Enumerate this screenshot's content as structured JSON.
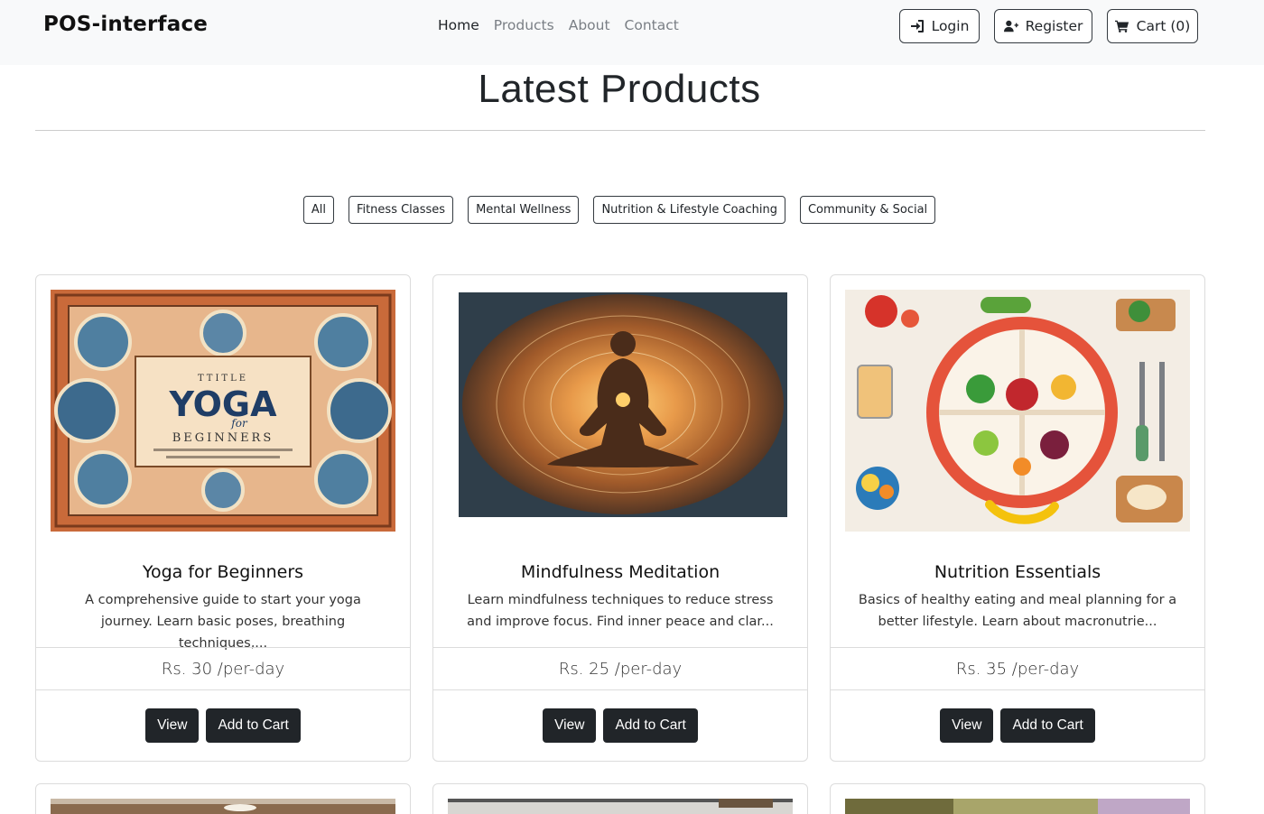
{
  "navbar": {
    "brand": "POS-interface",
    "links": [
      {
        "label": "Home",
        "active": true
      },
      {
        "label": "Products",
        "active": false
      },
      {
        "label": "About",
        "active": false
      },
      {
        "label": "Contact",
        "active": false
      }
    ],
    "login_label": "Login",
    "register_label": "Register",
    "cart_label": "Cart (0)",
    "icons": {
      "login": "sign-in-icon",
      "register": "user-plus-icon",
      "cart": "shopping-cart-icon"
    }
  },
  "main": {
    "title": "Latest Products",
    "filters": [
      "All",
      "Fitness Classes",
      "Mental Wellness",
      "Nutrition & Lifestyle Coaching",
      "Community & Social"
    ]
  },
  "products": [
    {
      "title": "Yoga for Beginners",
      "description": "A comprehensive guide to start your yoga journey. Learn basic poses, breathing techniques,...",
      "price": "Rs. 30 /per-day",
      "view_label": "View",
      "cart_label": "Add to Cart",
      "image": "yoga-book-cover-image",
      "image_text": {
        "line1": "TTITLE",
        "line2": "YOGA",
        "line3": "for",
        "line4": "BEGINNERS"
      }
    },
    {
      "title": "Mindfulness Meditation",
      "description": "Learn mindfulness techniques to reduce stress and improve focus. Find inner peace and clar...",
      "price": "Rs. 25 /per-day",
      "view_label": "View",
      "cart_label": "Add to Cart",
      "image": "meditation-silhouette-image"
    },
    {
      "title": "Nutrition Essentials",
      "description": "Basics of healthy eating and meal planning for a better lifestyle. Learn about macronutrie...",
      "price": "Rs. 35 /per-day",
      "view_label": "View",
      "cart_label": "Add to Cart",
      "image": "healthy-food-plate-image"
    }
  ],
  "colors": {
    "navbar_bg": "#f8f9fa",
    "dark_button": "#212529",
    "yoga_orange": "#c96a3a",
    "meditation_brown": "#5a3620",
    "food_bg": "#f3ede4"
  }
}
